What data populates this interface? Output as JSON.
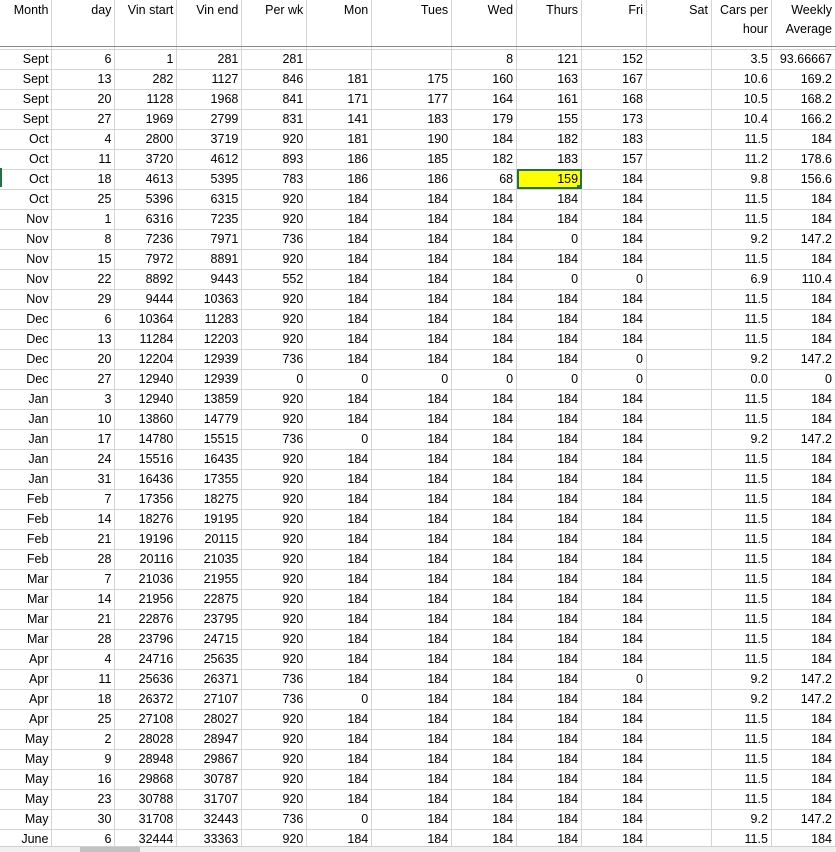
{
  "headers": [
    "Month",
    "day",
    "Vin start",
    "Vin end",
    "Per wk",
    "Mon",
    "Tues",
    "Wed",
    "Thurs",
    "Fri",
    "Sat",
    "Cars per|hour",
    "Weekly|Average"
  ],
  "rows": [
    [
      "Sept",
      "6",
      "1",
      "281",
      "281",
      "",
      "",
      "8",
      "121",
      "152",
      "",
      "3.5",
      "93.66667"
    ],
    [
      "Sept",
      "13",
      "282",
      "1127",
      "846",
      "181",
      "175",
      "160",
      "163",
      "167",
      "",
      "10.6",
      "169.2"
    ],
    [
      "Sept",
      "20",
      "1128",
      "1968",
      "841",
      "171",
      "177",
      "164",
      "161",
      "168",
      "",
      "10.5",
      "168.2"
    ],
    [
      "Sept",
      "27",
      "1969",
      "2799",
      "831",
      "141",
      "183",
      "179",
      "155",
      "173",
      "",
      "10.4",
      "166.2"
    ],
    [
      "Oct",
      "4",
      "2800",
      "3719",
      "920",
      "181",
      "190",
      "184",
      "182",
      "183",
      "",
      "11.5",
      "184"
    ],
    [
      "Oct",
      "11",
      "3720",
      "4612",
      "893",
      "186",
      "185",
      "182",
      "183",
      "157",
      "",
      "11.2",
      "178.6"
    ],
    [
      "Oct",
      "18",
      "4613",
      "5395",
      "783",
      "186",
      "186",
      "68",
      "159",
      "184",
      "",
      "9.8",
      "156.6"
    ],
    [
      "Oct",
      "25",
      "5396",
      "6315",
      "920",
      "184",
      "184",
      "184",
      "184",
      "184",
      "",
      "11.5",
      "184"
    ],
    [
      "Nov",
      "1",
      "6316",
      "7235",
      "920",
      "184",
      "184",
      "184",
      "184",
      "184",
      "",
      "11.5",
      "184"
    ],
    [
      "Nov",
      "8",
      "7236",
      "7971",
      "736",
      "184",
      "184",
      "184",
      "0",
      "184",
      "",
      "9.2",
      "147.2"
    ],
    [
      "Nov",
      "15",
      "7972",
      "8891",
      "920",
      "184",
      "184",
      "184",
      "184",
      "184",
      "",
      "11.5",
      "184"
    ],
    [
      "Nov",
      "22",
      "8892",
      "9443",
      "552",
      "184",
      "184",
      "184",
      "0",
      "0",
      "",
      "6.9",
      "110.4"
    ],
    [
      "Nov",
      "29",
      "9444",
      "10363",
      "920",
      "184",
      "184",
      "184",
      "184",
      "184",
      "",
      "11.5",
      "184"
    ],
    [
      "Dec",
      "6",
      "10364",
      "11283",
      "920",
      "184",
      "184",
      "184",
      "184",
      "184",
      "",
      "11.5",
      "184"
    ],
    [
      "Dec",
      "13",
      "11284",
      "12203",
      "920",
      "184",
      "184",
      "184",
      "184",
      "184",
      "",
      "11.5",
      "184"
    ],
    [
      "Dec",
      "20",
      "12204",
      "12939",
      "736",
      "184",
      "184",
      "184",
      "184",
      "0",
      "",
      "9.2",
      "147.2"
    ],
    [
      "Dec",
      "27",
      "12940",
      "12939",
      "0",
      "0",
      "0",
      "0",
      "0",
      "0",
      "",
      "0.0",
      "0"
    ],
    [
      "Jan",
      "3",
      "12940",
      "13859",
      "920",
      "184",
      "184",
      "184",
      "184",
      "184",
      "",
      "11.5",
      "184"
    ],
    [
      "Jan",
      "10",
      "13860",
      "14779",
      "920",
      "184",
      "184",
      "184",
      "184",
      "184",
      "",
      "11.5",
      "184"
    ],
    [
      "Jan",
      "17",
      "14780",
      "15515",
      "736",
      "0",
      "184",
      "184",
      "184",
      "184",
      "",
      "9.2",
      "147.2"
    ],
    [
      "Jan",
      "24",
      "15516",
      "16435",
      "920",
      "184",
      "184",
      "184",
      "184",
      "184",
      "",
      "11.5",
      "184"
    ],
    [
      "Jan",
      "31",
      "16436",
      "17355",
      "920",
      "184",
      "184",
      "184",
      "184",
      "184",
      "",
      "11.5",
      "184"
    ],
    [
      "Feb",
      "7",
      "17356",
      "18275",
      "920",
      "184",
      "184",
      "184",
      "184",
      "184",
      "",
      "11.5",
      "184"
    ],
    [
      "Feb",
      "14",
      "18276",
      "19195",
      "920",
      "184",
      "184",
      "184",
      "184",
      "184",
      "",
      "11.5",
      "184"
    ],
    [
      "Feb",
      "21",
      "19196",
      "20115",
      "920",
      "184",
      "184",
      "184",
      "184",
      "184",
      "",
      "11.5",
      "184"
    ],
    [
      "Feb",
      "28",
      "20116",
      "21035",
      "920",
      "184",
      "184",
      "184",
      "184",
      "184",
      "",
      "11.5",
      "184"
    ],
    [
      "Mar",
      "7",
      "21036",
      "21955",
      "920",
      "184",
      "184",
      "184",
      "184",
      "184",
      "",
      "11.5",
      "184"
    ],
    [
      "Mar",
      "14",
      "21956",
      "22875",
      "920",
      "184",
      "184",
      "184",
      "184",
      "184",
      "",
      "11.5",
      "184"
    ],
    [
      "Mar",
      "21",
      "22876",
      "23795",
      "920",
      "184",
      "184",
      "184",
      "184",
      "184",
      "",
      "11.5",
      "184"
    ],
    [
      "Mar",
      "28",
      "23796",
      "24715",
      "920",
      "184",
      "184",
      "184",
      "184",
      "184",
      "",
      "11.5",
      "184"
    ],
    [
      "Apr",
      "4",
      "24716",
      "25635",
      "920",
      "184",
      "184",
      "184",
      "184",
      "184",
      "",
      "11.5",
      "184"
    ],
    [
      "Apr",
      "11",
      "25636",
      "26371",
      "736",
      "184",
      "184",
      "184",
      "184",
      "0",
      "",
      "9.2",
      "147.2"
    ],
    [
      "Apr",
      "18",
      "26372",
      "27107",
      "736",
      "0",
      "184",
      "184",
      "184",
      "184",
      "",
      "9.2",
      "147.2"
    ],
    [
      "Apr",
      "25",
      "27108",
      "28027",
      "920",
      "184",
      "184",
      "184",
      "184",
      "184",
      "",
      "11.5",
      "184"
    ],
    [
      "May",
      "2",
      "28028",
      "28947",
      "920",
      "184",
      "184",
      "184",
      "184",
      "184",
      "",
      "11.5",
      "184"
    ],
    [
      "May",
      "9",
      "28948",
      "29867",
      "920",
      "184",
      "184",
      "184",
      "184",
      "184",
      "",
      "11.5",
      "184"
    ],
    [
      "May",
      "16",
      "29868",
      "30787",
      "920",
      "184",
      "184",
      "184",
      "184",
      "184",
      "",
      "11.5",
      "184"
    ],
    [
      "May",
      "23",
      "30788",
      "31707",
      "920",
      "184",
      "184",
      "184",
      "184",
      "184",
      "",
      "11.5",
      "184"
    ],
    [
      "May",
      "30",
      "31708",
      "32443",
      "736",
      "0",
      "184",
      "184",
      "184",
      "184",
      "",
      "9.2",
      "147.2"
    ],
    [
      "June",
      "6",
      "32444",
      "33363",
      "920",
      "184",
      "184",
      "184",
      "184",
      "184",
      "",
      "11.5",
      "184"
    ]
  ],
  "selected_cell": {
    "row": 6,
    "col": 8,
    "highlight": "#ffff00",
    "border": "#217346"
  }
}
